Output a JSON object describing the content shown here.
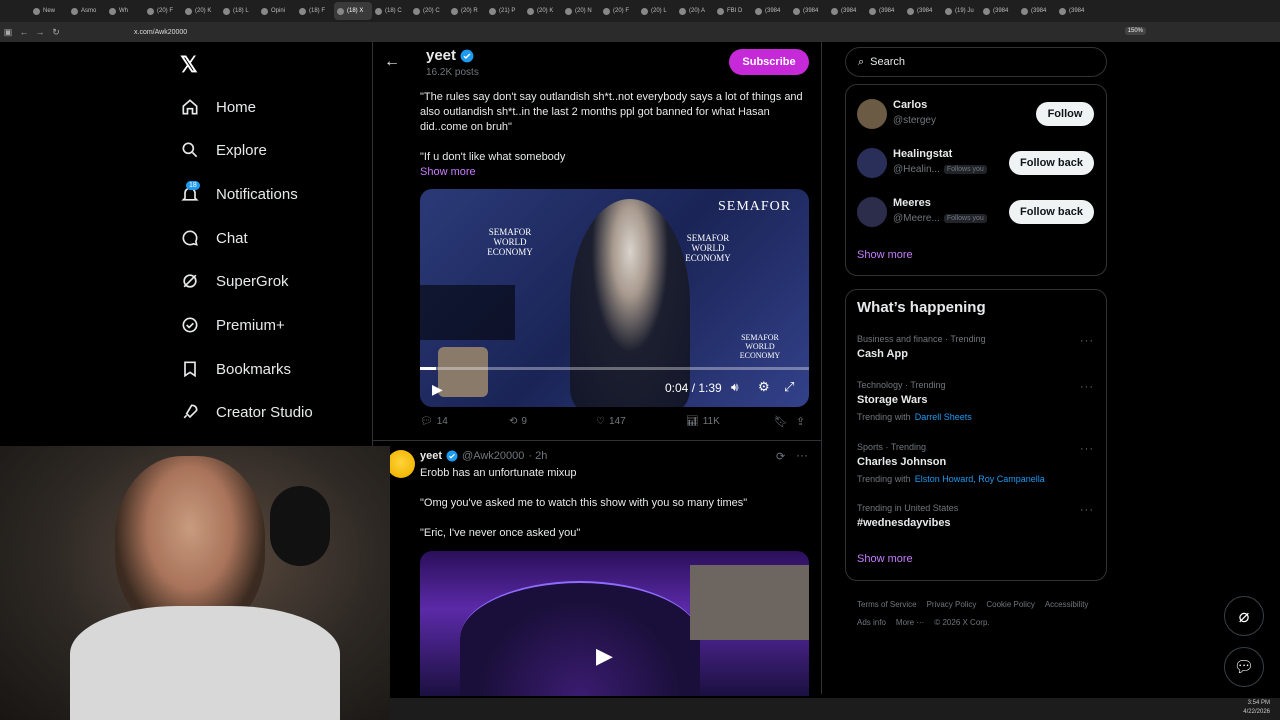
{
  "browser": {
    "tabs": [
      "New",
      "Asmo",
      "Wh",
      "(20) F",
      "(20) K",
      "(18) L",
      "Opini",
      "(18) F",
      "(18) X",
      "(18) C",
      "(20) C",
      "(20) R",
      "(21) P",
      "(20) K",
      "(20) N",
      "(20) F",
      "(20) L",
      "(20) A",
      "FBI D",
      "(3984",
      "(3984",
      "(3984",
      "(3984",
      "(3984",
      "(19) Ju",
      "(3984",
      "(3984",
      "(3984"
    ],
    "url": "x.com/Awk20000",
    "zoom": "150%"
  },
  "nav": {
    "items": [
      {
        "label": "Home",
        "icon": "home-icon"
      },
      {
        "label": "Explore",
        "icon": "search-icon"
      },
      {
        "label": "Notifications",
        "icon": "bell-icon"
      },
      {
        "label": "Chat",
        "icon": "chat-icon"
      },
      {
        "label": "SuperGrok",
        "icon": "grok-icon"
      },
      {
        "label": "Premium+",
        "icon": "verified-icon"
      },
      {
        "label": "Bookmarks",
        "icon": "bookmark-icon"
      },
      {
        "label": "Creator Studio",
        "icon": "rocket-icon"
      }
    ],
    "notification_count": "18"
  },
  "profile_header": {
    "name": "yeet",
    "posts": "16.2K posts",
    "subscribe_label": "Subscribe"
  },
  "post1": {
    "text1": "\"The rules say don't say outlandish sh*t..not everybody says a lot of things and also outlandish sh*t..in the last 2 months ppl got banned for what Hasan did..come on bruh\"",
    "text2": "\"If u don't like what somebody",
    "show_more": "Show more",
    "video_time": "0:04 / 1:39",
    "video_brand": "SEMAFOR",
    "video_backdrop": "SEMAFOR WORLD ECONOMY",
    "replies": "14",
    "reposts": "9",
    "likes": "147",
    "views": "11K"
  },
  "post2": {
    "name": "yeet",
    "handle": "@Awk20000",
    "time": "· 2h",
    "text1": "Erobb has an unfortunate mixup",
    "text2": "\"Omg you've asked me to watch this show with you so many times\"",
    "text3": "\"Eric, I've never once asked you\""
  },
  "search": {
    "placeholder": "Search"
  },
  "who_to_follow": [
    {
      "name": "Carlos",
      "handle": "@stergey",
      "button": "Follow",
      "follows_you": ""
    },
    {
      "name": "Healingstat",
      "handle": "@Healin...",
      "button": "Follow back",
      "follows_you": "Follows you"
    },
    {
      "name": "Meeres",
      "handle": "@Meere...",
      "button": "Follow back",
      "follows_you": "Follows you"
    }
  ],
  "who_show_more": "Show more",
  "trends": {
    "title": "What’s happening",
    "items": [
      {
        "context": "Business and finance · Trending",
        "name": "Cash App",
        "with_label": "",
        "with": ""
      },
      {
        "context": "Technology · Trending",
        "name": "Storage Wars",
        "with_label": "Trending with",
        "with": "Darrell Sheets"
      },
      {
        "context": "Sports · Trending",
        "name": "Charles Johnson",
        "with_label": "Trending with",
        "with": "Elston Howard, Roy Campanella"
      },
      {
        "context": "Trending in United States",
        "name": "#wednesdayvibes",
        "with_label": "",
        "with": ""
      }
    ],
    "show_more": "Show more"
  },
  "footer": {
    "links": [
      "Terms of Service",
      "Privacy Policy",
      "Cookie Policy",
      "Accessibility",
      "Ads info",
      "More ···",
      "© 2026 X Corp."
    ]
  },
  "taskbar": {
    "time": "3:54 PM",
    "date": "4/22/2026"
  }
}
